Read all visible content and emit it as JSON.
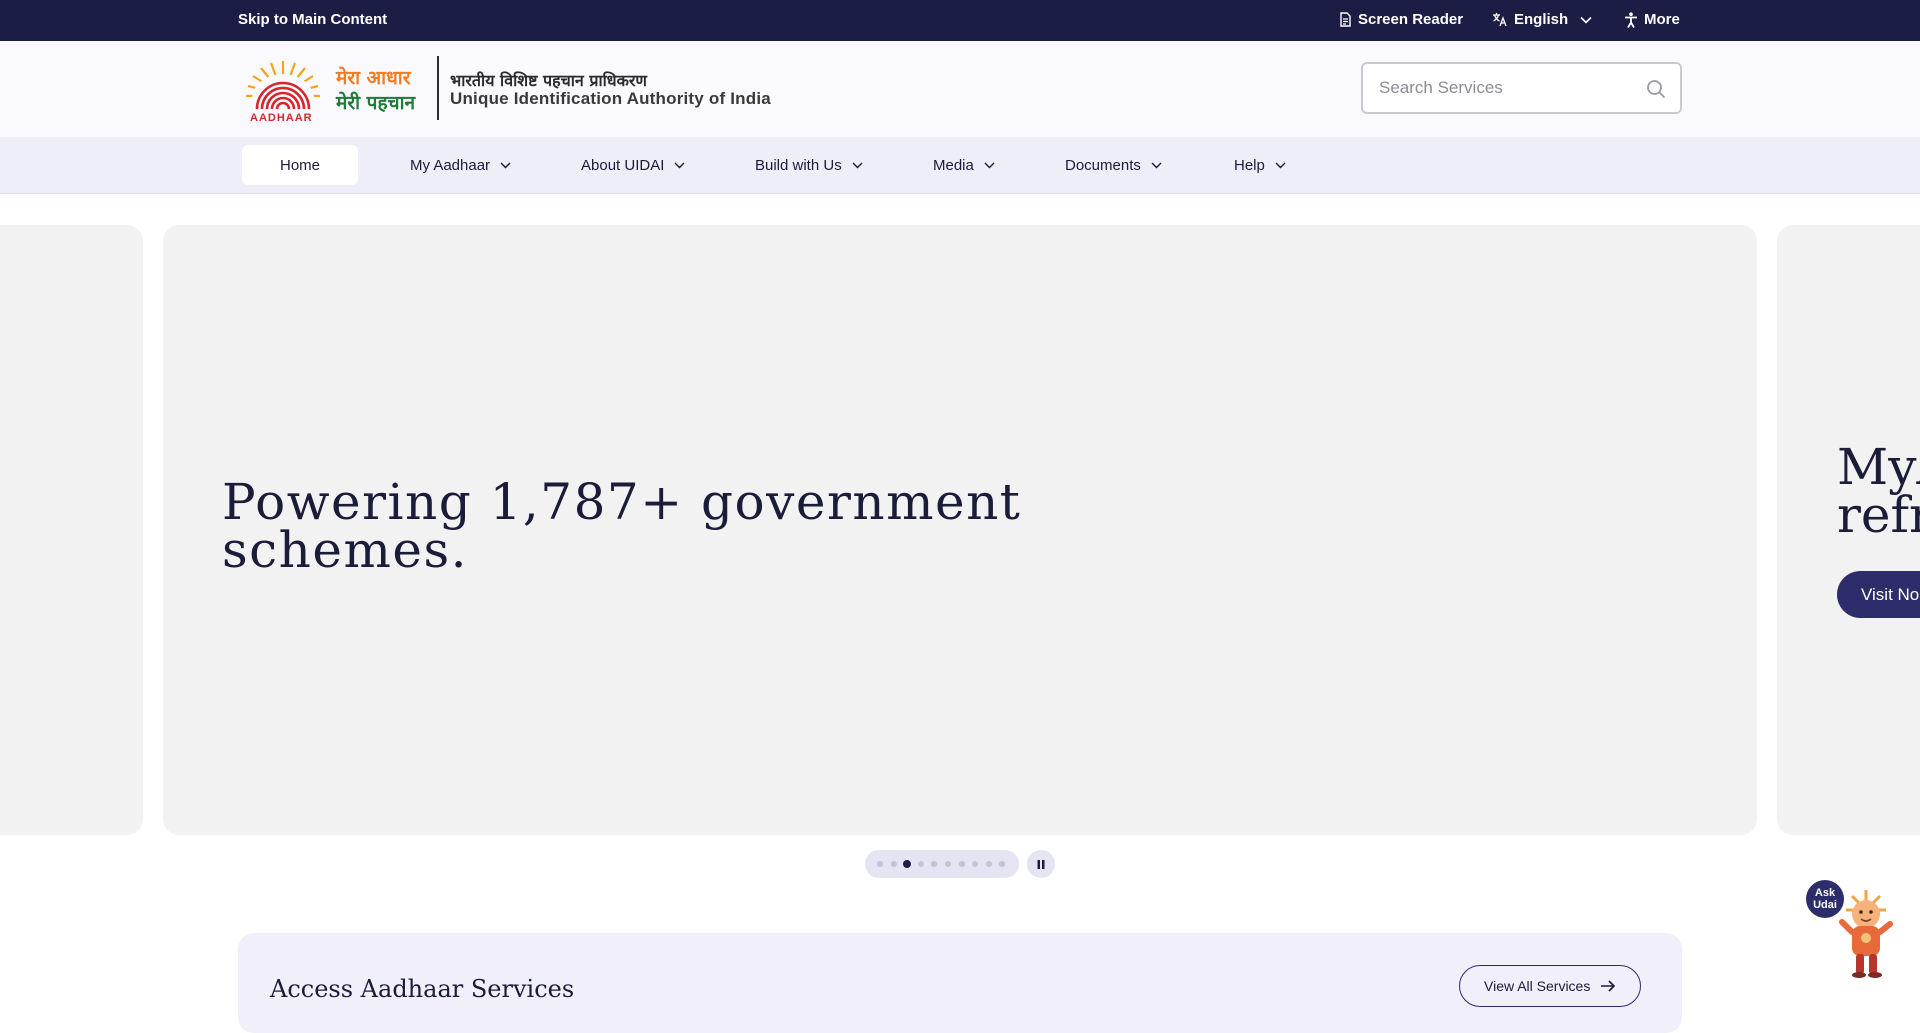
{
  "topbar": {
    "skip_link": "Skip to Main Content",
    "screen_reader": "Screen Reader",
    "language": "English",
    "more": "More"
  },
  "header": {
    "logo_hindi_line1": "मेरा आधार",
    "logo_hindi_line2": "मेरी पहचान",
    "logo_wordmark": "AADHAAR",
    "org_name_hindi": "भारतीय विशिष्ट पहचान प्राधिकरण",
    "org_name_english": "Unique Identification Authority of India",
    "search_placeholder": "Search Services"
  },
  "nav": {
    "items": [
      {
        "label": "Home",
        "has_menu": false
      },
      {
        "label": "My Aadhaar",
        "has_menu": true
      },
      {
        "label": "About UIDAI",
        "has_menu": true
      },
      {
        "label": "Build with Us",
        "has_menu": true
      },
      {
        "label": "Media",
        "has_menu": true
      },
      {
        "label": "Documents",
        "has_menu": true
      },
      {
        "label": "Help",
        "has_menu": true
      }
    ]
  },
  "carousel": {
    "current_slide_title": "Powering 1,787+ government schemes.",
    "next_slide_title_visible": "MyA\nrefr",
    "next_slide_button_visible": "Visit No",
    "slide_count": 10,
    "active_index": 2
  },
  "services": {
    "title": "Access Aadhaar Services",
    "view_all": "View All Services"
  },
  "assistant": {
    "badge_line1": "Ask",
    "badge_line2": "Udai"
  },
  "colors": {
    "topbar": "#1c1d45",
    "nav_bg": "#eeeef9",
    "slide_bg": "#f2f2f2",
    "accent_button": "#2d2d6b",
    "logo_orange": "#f47b20",
    "logo_red": "#d6262b",
    "logo_green": "#1e7b3c"
  },
  "icons": {
    "screen_reader": "document-icon",
    "language": "translate-icon",
    "more": "accessibility-icon",
    "search": "search-icon",
    "pause": "pause-icon",
    "view_all": "arrow-right-icon"
  }
}
